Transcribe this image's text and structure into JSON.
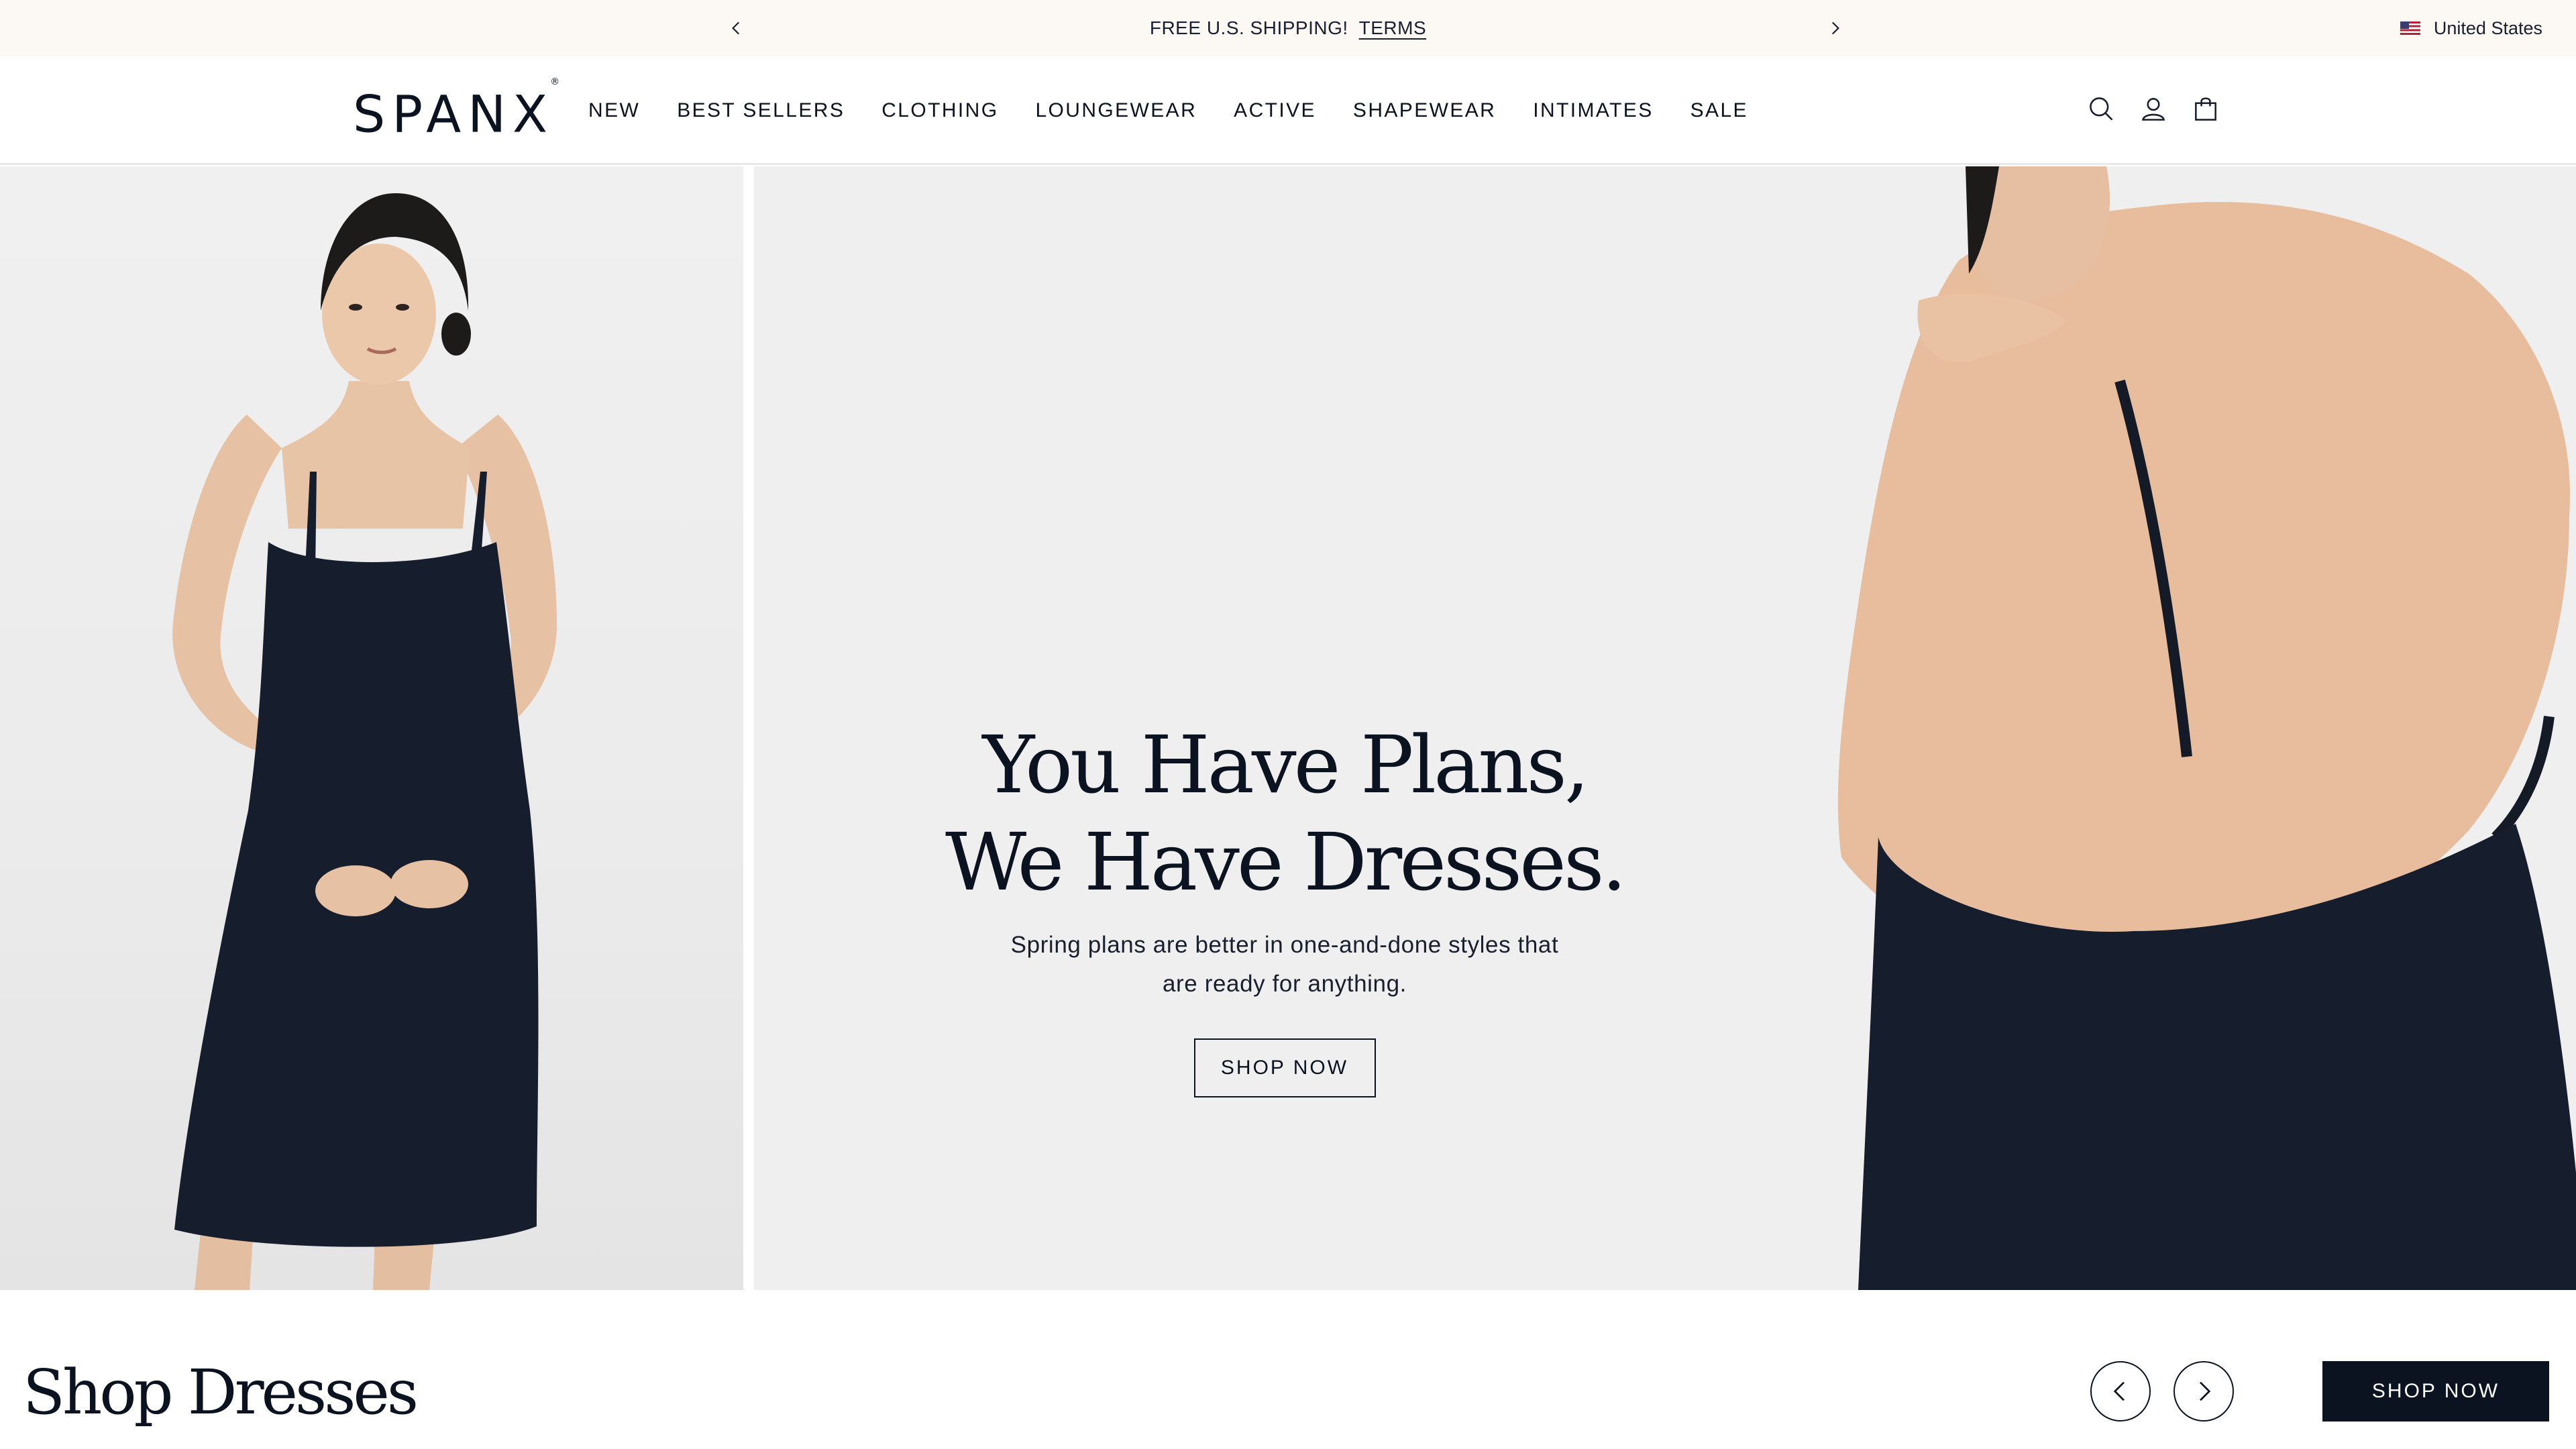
{
  "announcement": {
    "message": "FREE U.S. SHIPPING!",
    "link": "TERMS",
    "prev_icon": "chevron-left-icon",
    "next_icon": "chevron-right-icon"
  },
  "region": {
    "label": "United States",
    "flag_icon": "us-flag-icon"
  },
  "header": {
    "logo": "SPANX",
    "logo_mark": "®",
    "nav": [
      "NEW",
      "BEST SELLERS",
      "CLOTHING",
      "LOUNGEWEAR",
      "ACTIVE",
      "SHAPEWEAR",
      "INTIMATES",
      "SALE"
    ],
    "icons": [
      "search-icon",
      "account-icon",
      "bag-icon"
    ]
  },
  "hero": {
    "title_line1": "You Have Plans,",
    "title_line2": "We Have Dresses.",
    "subtitle_line1": "Spring plans are better in one-and-done styles that",
    "subtitle_line2": "are ready for anything.",
    "cta": "SHOP NOW"
  },
  "shop_section": {
    "title": "Shop Dresses",
    "cta": "SHOP NOW"
  },
  "colors": {
    "navy": "#0b1220",
    "announcement_bg": "#fcf8f4",
    "hero_bg": "#efefef",
    "skin": "#e8c1a4",
    "hair": "#1d1a1a"
  }
}
